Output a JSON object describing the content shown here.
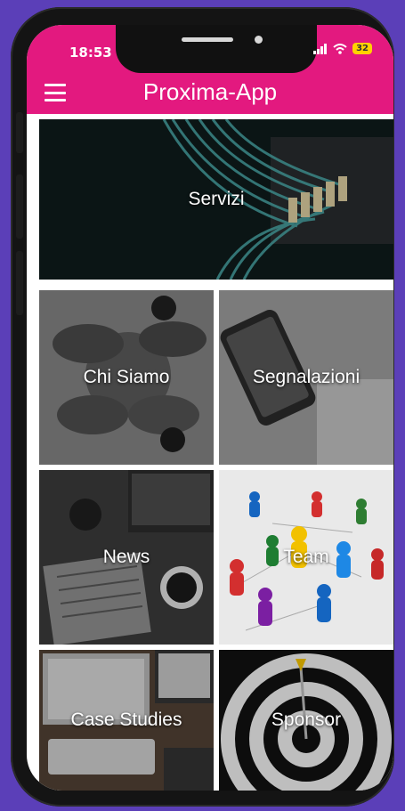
{
  "status_bar": {
    "time": "18:53",
    "battery": "32"
  },
  "app_bar": {
    "title": "Proxima-App",
    "menu_icon": "hamburger-menu-icon"
  },
  "tiles": [
    {
      "id": "servizi",
      "label": "Servizi"
    },
    {
      "id": "chi-siamo",
      "label": "Chi Siamo"
    },
    {
      "id": "segnalazioni",
      "label": "Segnalazioni"
    },
    {
      "id": "news",
      "label": "News"
    },
    {
      "id": "team",
      "label": "Team"
    },
    {
      "id": "case-studies",
      "label": "Case Studies"
    },
    {
      "id": "sponsor",
      "label": "Sponsor"
    }
  ],
  "colors": {
    "accent": "#e3197f",
    "background": "#5b3fb8"
  }
}
